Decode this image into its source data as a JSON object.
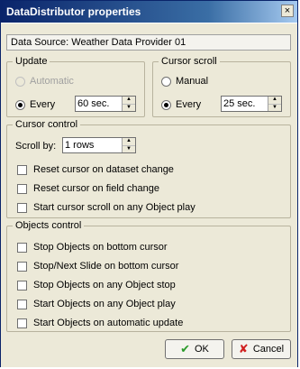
{
  "window": {
    "title": "DataDistributor properties",
    "close_glyph": "×"
  },
  "source": {
    "label": "Data Source: Weather Data Provider 01"
  },
  "update": {
    "legend": "Update",
    "automatic_label": "Automatic",
    "every_label": "Every",
    "every_value": "60 sec.",
    "selected": "every"
  },
  "cursor_scroll": {
    "legend": "Cursor scroll",
    "manual_label": "Manual",
    "every_label": "Every",
    "every_value": "25 sec.",
    "selected": "every"
  },
  "cursor_control": {
    "legend": "Cursor control",
    "scroll_by_label": "Scroll by:",
    "scroll_by_value": "1 rows",
    "options": [
      "Reset cursor on dataset change",
      "Reset cursor on field change",
      "Start cursor scroll on any Object play"
    ]
  },
  "objects_control": {
    "legend": "Objects control",
    "options": [
      "Stop Objects on bottom cursor",
      "Stop/Next Slide on bottom cursor",
      "Stop Objects on any Object stop",
      "Start Objects on any Object play",
      "Start Objects on automatic update"
    ]
  },
  "buttons": {
    "ok_label": "OK",
    "ok_icon": "✔",
    "cancel_label": "Cancel",
    "cancel_icon": "✘"
  },
  "colors": {
    "title_bar": "#0a246a",
    "dialog_bg": "#ece9d8"
  }
}
